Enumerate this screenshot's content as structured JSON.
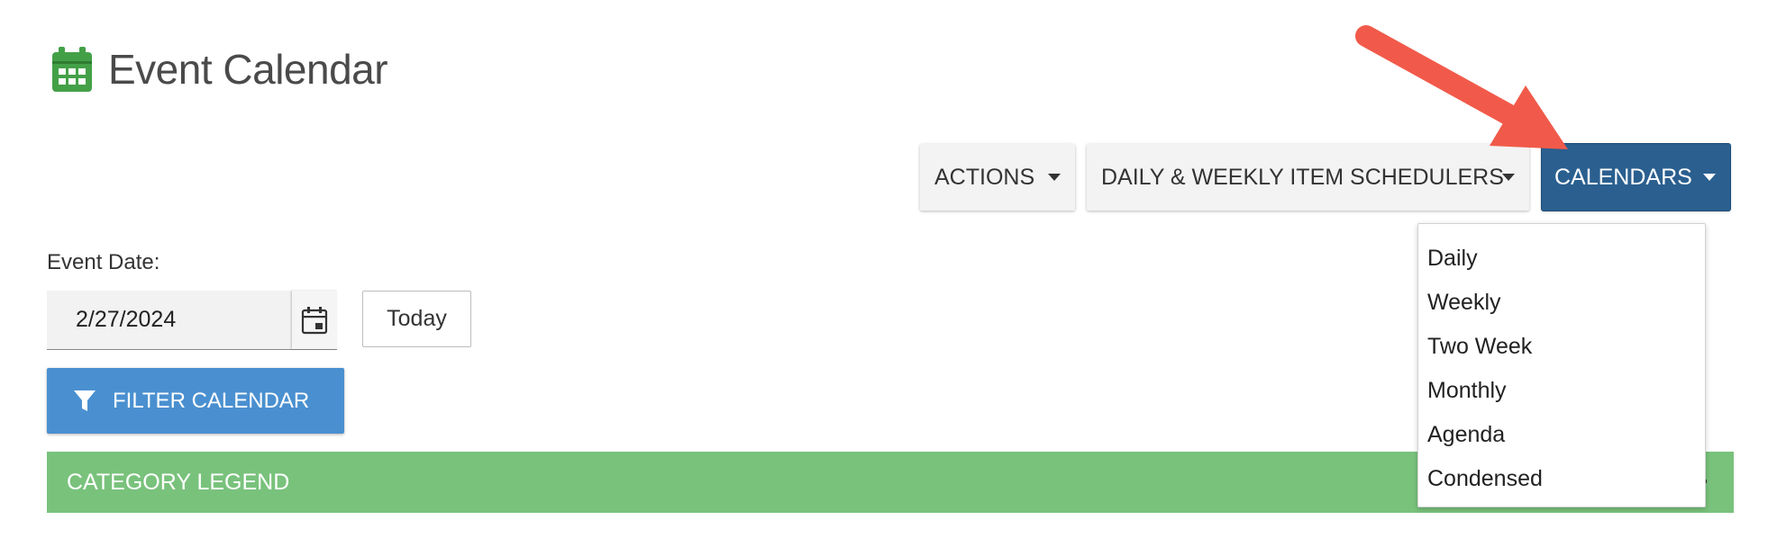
{
  "header": {
    "title": "Event Calendar"
  },
  "toolbar": {
    "actions_label": "ACTIONS",
    "schedulers_label": "DAILY & WEEKLY ITEM SCHEDULERS",
    "calendars_label": "CALENDARS"
  },
  "event_date": {
    "label": "Event Date:",
    "value": "2/27/2024",
    "today_label": "Today"
  },
  "filter": {
    "label": "FILTER CALENDAR"
  },
  "legend": {
    "title": "CATEGORY LEGEND"
  },
  "calendars_menu": {
    "items": [
      "Daily",
      "Weekly",
      "Two Week",
      "Monthly",
      "Agenda",
      "Condensed"
    ]
  },
  "colors": {
    "brand_green": "#43a047",
    "calendars_button": "#2a5f8f",
    "filter_button": "#4a90d0",
    "legend_bar": "#79c27c",
    "annotation_arrow": "#f15a4a"
  },
  "icons": {
    "title": "calendar-icon",
    "date_picker": "calendar-icon",
    "filter": "funnel-icon",
    "legend_toggle": "plus-icon"
  }
}
